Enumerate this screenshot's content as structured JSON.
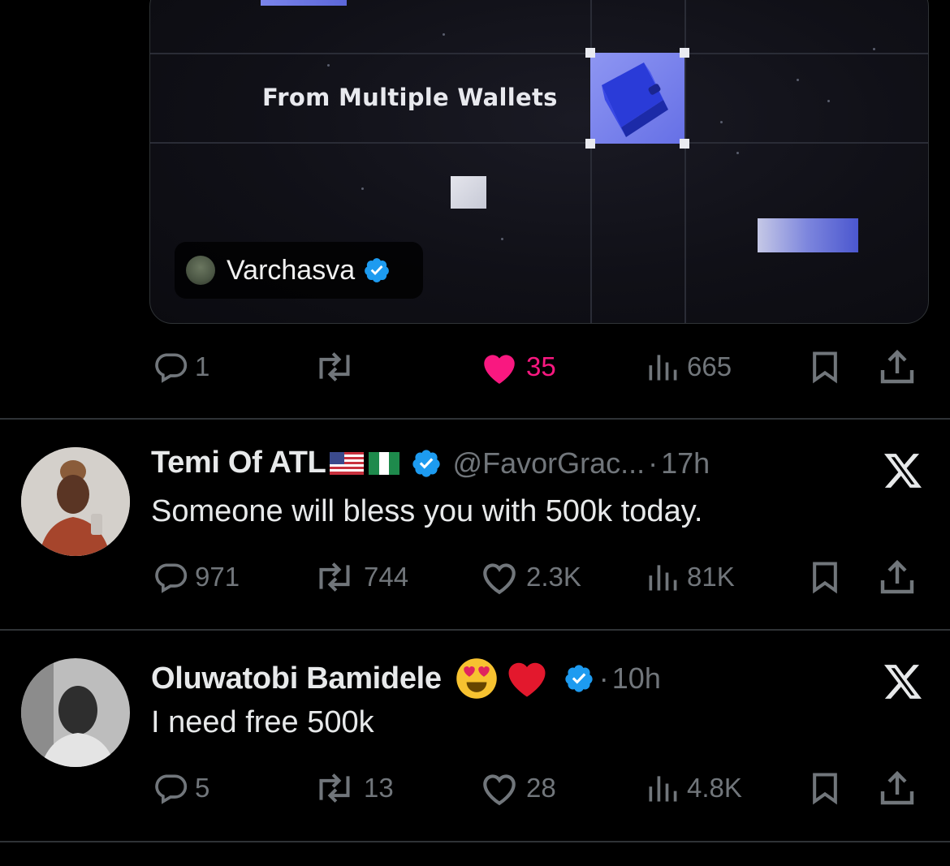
{
  "media": {
    "caption": "From Multiple Wallets",
    "author_name": "Varchasva"
  },
  "tweet0": {
    "replies": "1",
    "retweets": "",
    "likes": "35",
    "views": "665"
  },
  "tweet1": {
    "display_name": "Temi Of ATL",
    "handle": "@FavorGrac...",
    "dot": "·",
    "time": "17h",
    "text": "Someone will bless you with 500k today.",
    "replies": "971",
    "retweets": "744",
    "likes": "2.3K",
    "views": "81K"
  },
  "tweet2": {
    "display_name": "Oluwatobi Bamidele",
    "dot": "·",
    "time": "10h",
    "text": "I need free 500k",
    "replies": "5",
    "retweets": "13",
    "likes": "28",
    "views": "4.8K"
  },
  "colors": {
    "background": "#000000",
    "muted": "#71767b",
    "like_pink": "#f91880",
    "verified_blue": "#1d9bf0",
    "divider": "#2f3336"
  }
}
